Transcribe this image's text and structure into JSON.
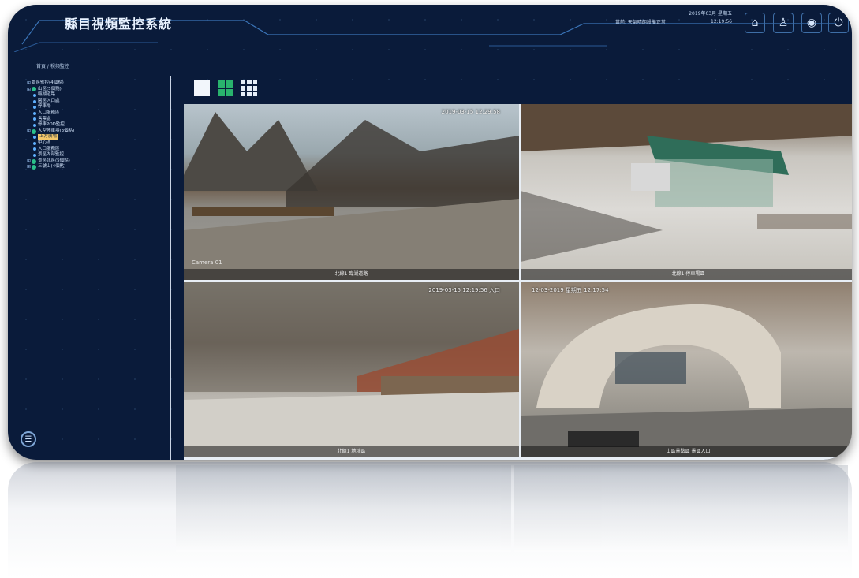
{
  "header": {
    "title": "縣目視頻監控系統",
    "status_text": "當前: 天氣晴朗設備正常",
    "date": "2019年03月 星期五",
    "time": "12:19:56",
    "buttons": [
      {
        "name": "home",
        "icon": "⌂"
      },
      {
        "name": "user",
        "icon": "♙"
      },
      {
        "name": "settings",
        "icon": "◉"
      },
      {
        "name": "power",
        "icon": "⏻"
      }
    ]
  },
  "breadcrumb": "首頁 / 視頻監控",
  "tree": [
    {
      "level": 0,
      "kind": "root",
      "label": "景區監控(4個點)"
    },
    {
      "level": 0,
      "kind": "group",
      "label": "山區(5個點)"
    },
    {
      "level": 1,
      "kind": "camera",
      "label": "臨湖道路"
    },
    {
      "level": 1,
      "kind": "camera",
      "label": "園區入口處"
    },
    {
      "level": 1,
      "kind": "camera",
      "label": "停車場"
    },
    {
      "level": 1,
      "kind": "camera",
      "label": "入口服務區"
    },
    {
      "level": 1,
      "kind": "camera",
      "label": "售票處"
    },
    {
      "level": 1,
      "kind": "camera",
      "label": "停車POD監控"
    },
    {
      "level": 0,
      "kind": "group",
      "label": "大型停車場(3個點)"
    },
    {
      "level": 1,
      "kind": "selected",
      "label": "上方廣場"
    },
    {
      "level": 1,
      "kind": "camera",
      "label": "中心區"
    },
    {
      "level": 1,
      "kind": "camera",
      "label": "入口服務區"
    },
    {
      "level": 1,
      "kind": "camera",
      "label": "景區內部監控"
    },
    {
      "level": 0,
      "kind": "group",
      "label": "景區北區(5個點)"
    },
    {
      "level": 0,
      "kind": "group",
      "label": "三號山(4個點)"
    }
  ],
  "layout_options": [
    "single",
    "quad",
    "nine"
  ],
  "active_layout": "quad",
  "tiles": [
    {
      "timestamp": "2019-03-15 12:29:58",
      "label": "北線1 臨湖道路",
      "osd": "Camera 01"
    },
    {
      "timestamp": "",
      "label": "北線1 停車場區",
      "osd": ""
    },
    {
      "timestamp": "2019-03-15 12:19:56 入口",
      "label": "北線1 地址區",
      "osd": ""
    },
    {
      "timestamp": "12-03-2019 星期五 12:17:54",
      "label": "山區景點區 景區入口",
      "osd": ""
    }
  ],
  "colors": {
    "background": "#0a1b3a",
    "accent": "#29b36d",
    "selected": "#f3c76a"
  }
}
